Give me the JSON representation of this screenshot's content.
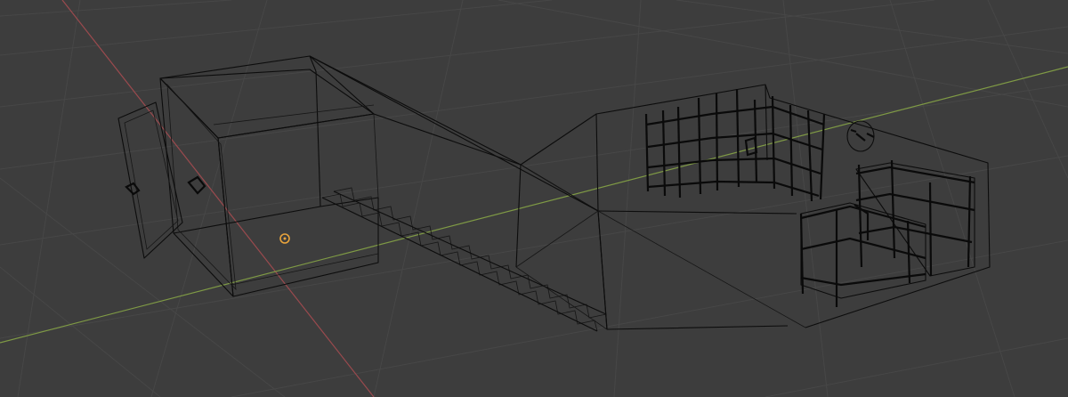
{
  "viewport": {
    "view_mode": "wireframe",
    "colors": {
      "background": "#3d3d3d",
      "grid": "#474747",
      "x_axis": "#9a4a4e",
      "y_axis": "#7f9a45",
      "wireframe": "#0c0c0c",
      "origin_marker": "#e8a33c"
    },
    "objects": [
      {
        "name": "box-room",
        "icon": "wire-box"
      },
      {
        "name": "door",
        "icon": "wire-door"
      },
      {
        "name": "staircase",
        "icon": "wire-stairs"
      },
      {
        "name": "corridor",
        "icon": "wire-corridor"
      },
      {
        "name": "shelves",
        "icon": "wire-shelves"
      },
      {
        "name": "bunk-bed",
        "icon": "wire-bed"
      },
      {
        "name": "wall-clock",
        "icon": "wire-clock"
      }
    ],
    "origin": {
      "icon": "origin-icon"
    }
  }
}
